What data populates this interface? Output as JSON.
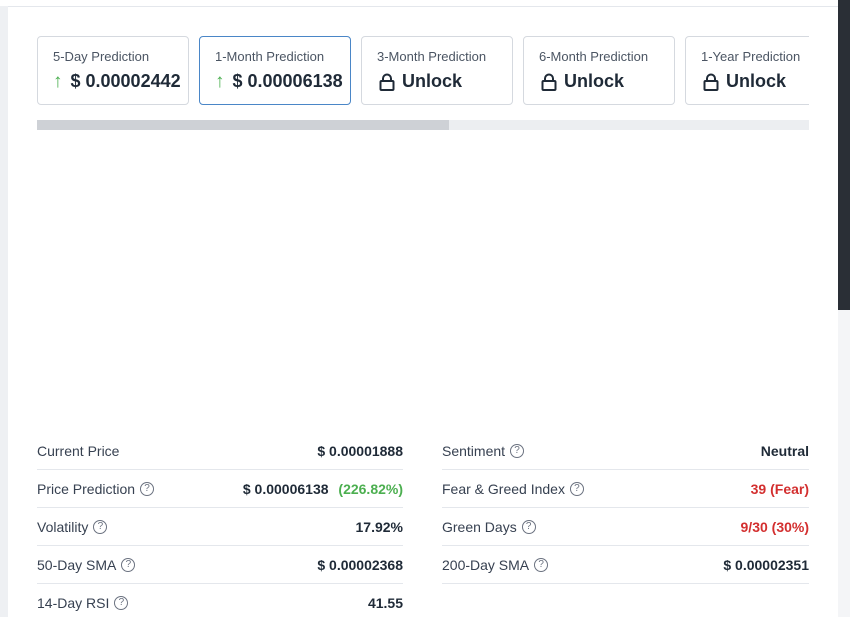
{
  "cards": [
    {
      "label": "5-Day Prediction",
      "value": "$ 0.00002442",
      "kind": "up"
    },
    {
      "label": "1-Month Prediction",
      "value": "$ 0.00006138",
      "kind": "up",
      "active": true
    },
    {
      "label": "3-Month Prediction",
      "value": "Unlock",
      "kind": "lock"
    },
    {
      "label": "6-Month Prediction",
      "value": "Unlock",
      "kind": "lock"
    },
    {
      "label": "1-Year Prediction",
      "value": "Unlock",
      "kind": "lock"
    }
  ],
  "stats_left": [
    {
      "label": "Current Price",
      "value": "$ 0.00001888"
    },
    {
      "label": "Price Prediction",
      "value": "$ 0.00006138",
      "extra": "(226.82%)"
    },
    {
      "label": "Volatility",
      "value": "17.92%"
    },
    {
      "label": "50-Day SMA",
      "value": "$ 0.00002368"
    },
    {
      "label": "14-Day RSI",
      "value": "41.55"
    }
  ],
  "stats_right": [
    {
      "label": "Sentiment",
      "value": "Neutral"
    },
    {
      "label": "Fear & Greed Index",
      "value": "39 (Fear)"
    },
    {
      "label": "Green Days",
      "value": "9/30 (30%)"
    },
    {
      "label": "200-Day SMA",
      "value": "$ 0.00002351"
    }
  ],
  "icons": {
    "up": "arrow-up-icon",
    "lock": "lock-icon",
    "help": "help-circle-icon"
  },
  "colors": {
    "positive": "#4caf50",
    "negative": "#d32f2f",
    "active_border": "#4a86c7"
  }
}
